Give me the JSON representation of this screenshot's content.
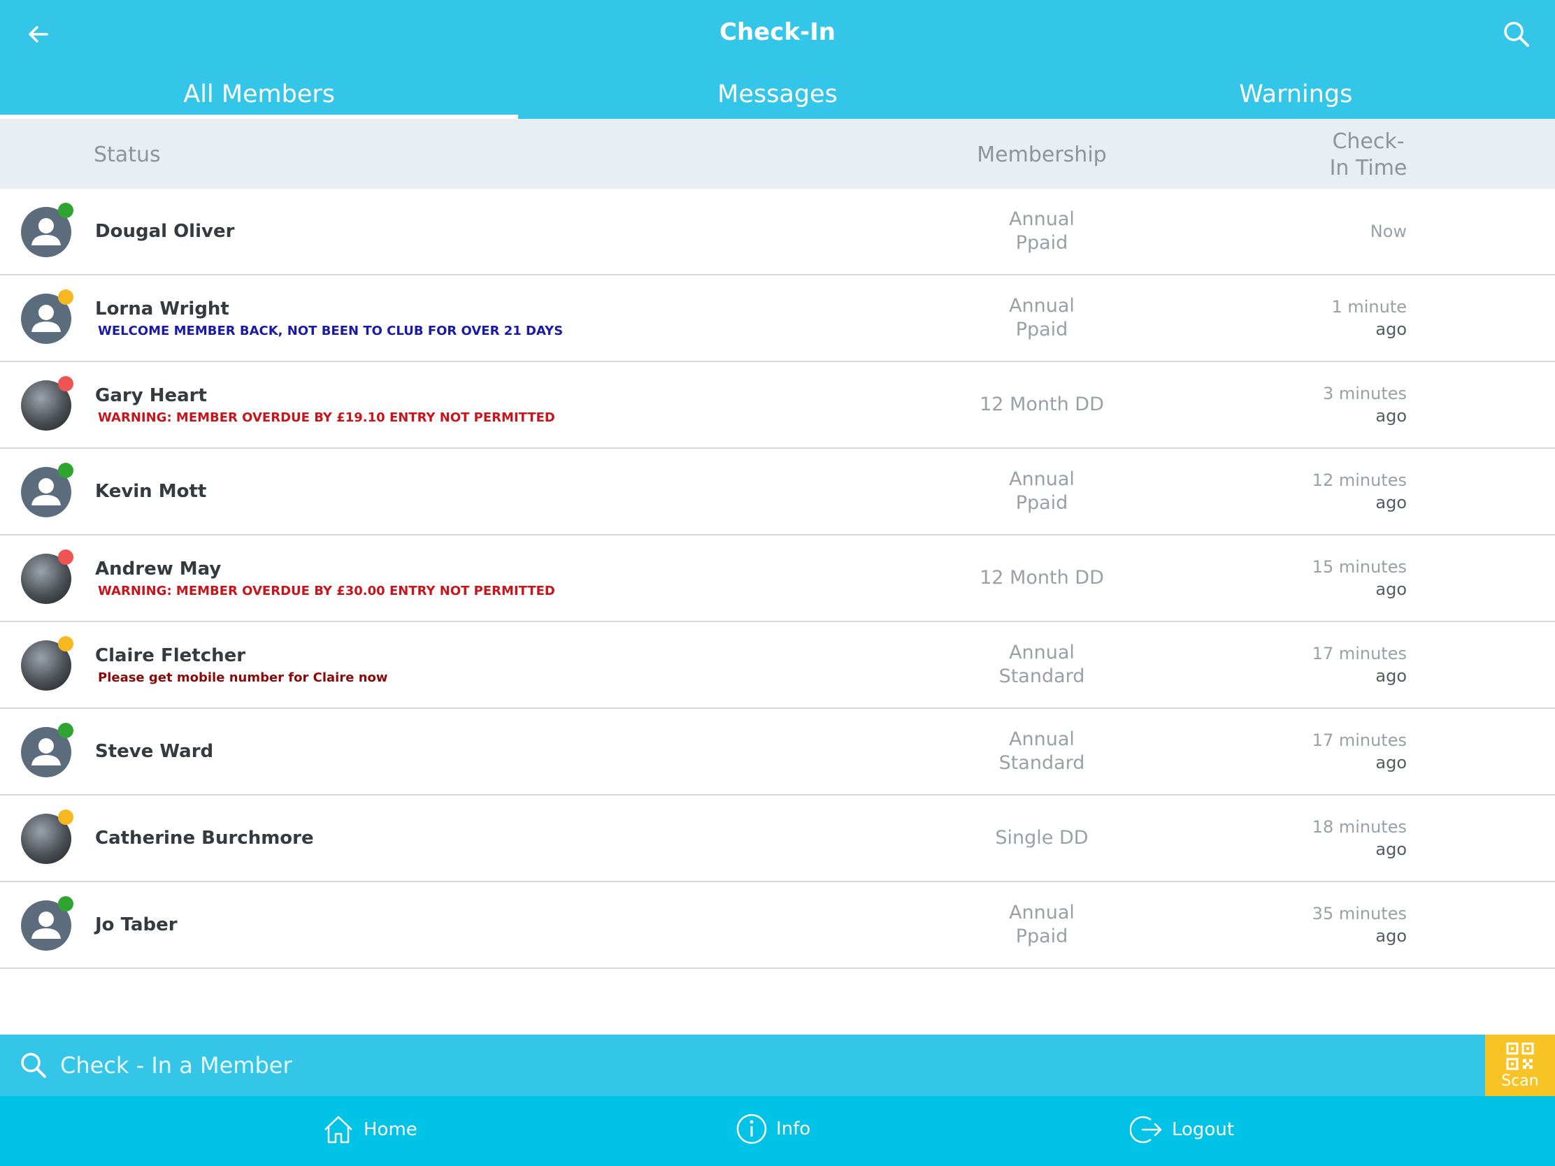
{
  "header": {
    "title": "Check-In",
    "back_icon": "arrow-left-icon",
    "search_icon": "search-icon"
  },
  "tabs": [
    {
      "label": "All Members",
      "active": true
    },
    {
      "label": "Messages",
      "active": false
    },
    {
      "label": "Warnings",
      "active": false
    }
  ],
  "columns": {
    "status": "Status",
    "membership": "Membership",
    "checkin_time": "Check-\nIn Time"
  },
  "members": [
    {
      "name": "Dougal Oliver",
      "message": "",
      "membership": "Annual\nPpaid",
      "time": "Now",
      "time_suffix": "",
      "status_color": "#2fa52f",
      "avatar": "placeholder"
    },
    {
      "name": "Lorna Wright",
      "message": "WELCOME MEMBER BACK, NOT BEEN TO CLUB FOR OVER 21 DAYS",
      "message_color": "#1a1aa6",
      "membership": "Annual\nPpaid",
      "time": "1 minute",
      "time_suffix": "ago",
      "status_color": "#f5b820",
      "avatar": "placeholder"
    },
    {
      "name": "Gary Heart",
      "message": "WARNING: MEMBER OVERDUE BY £19.10 ENTRY NOT PERMITTED",
      "message_color": "#c8141b",
      "membership": "12 Month DD",
      "time": "3 minutes",
      "time_suffix": "ago",
      "status_color": "#ee5454",
      "avatar": "photo"
    },
    {
      "name": "Kevin Mott",
      "message": "",
      "membership": "Annual\nPpaid",
      "time": "12 minutes",
      "time_suffix": "ago",
      "status_color": "#2fa52f",
      "avatar": "placeholder"
    },
    {
      "name": "Andrew May",
      "message": "WARNING: MEMBER OVERDUE BY £30.00  ENTRY NOT PERMITTED",
      "message_color": "#c8141b",
      "membership": "12 Month DD",
      "time": "15 minutes",
      "time_suffix": "ago",
      "status_color": "#ee5454",
      "avatar": "photo"
    },
    {
      "name": "Claire Fletcher",
      "message": "Please get mobile number for Claire now",
      "message_color": "#8a0a0a",
      "membership": "Annual\nStandard",
      "time": "17 minutes",
      "time_suffix": "ago",
      "status_color": "#f5b820",
      "avatar": "photo"
    },
    {
      "name": "Steve Ward",
      "message": "",
      "membership": "Annual\nStandard",
      "time": "17 minutes",
      "time_suffix": "ago",
      "status_color": "#2fa52f",
      "avatar": "placeholder"
    },
    {
      "name": "Catherine Burchmore",
      "message": "",
      "membership": "Single DD",
      "time": "18 minutes",
      "time_suffix": "ago",
      "status_color": "#f5b820",
      "avatar": "photo"
    },
    {
      "name": "Jo Taber",
      "message": "",
      "membership": "Annual\nPpaid",
      "time": "35 minutes",
      "time_suffix": "ago",
      "status_color": "#2fa52f",
      "avatar": "placeholder"
    }
  ],
  "checkin": {
    "placeholder": "Check - In a Member",
    "scan_label": "Scan"
  },
  "bottom_nav": {
    "home_label": "Home",
    "info_label": "Info",
    "logout_label": "Logout"
  },
  "colors": {
    "header": "#33c6e8",
    "nav": "#00c3e6",
    "scan": "#f7c325",
    "column_header": "#e8eff3"
  }
}
